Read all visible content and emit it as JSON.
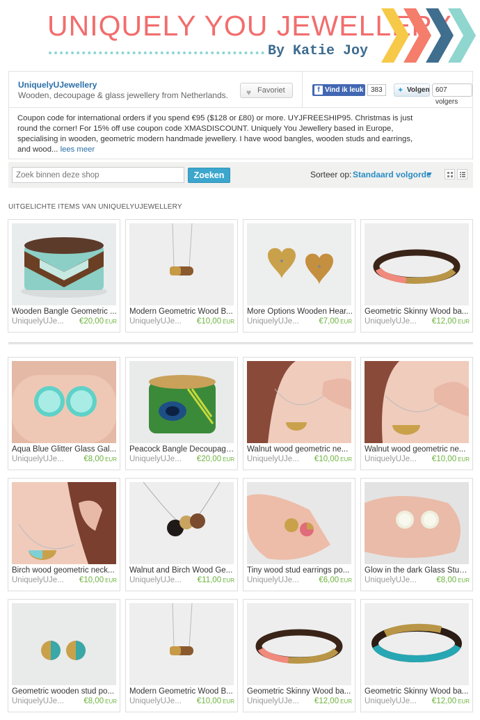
{
  "banner": {
    "title": "UNIQUELY YOU JEWELLERY",
    "subtitle": "By Katie Joy",
    "chevron_colors": [
      "#f7c948",
      "#f47d6b",
      "#3f6e8e",
      "#8fd6cf"
    ]
  },
  "shop": {
    "name": "UniquelyUJewellery",
    "tagline": "Wooden, decoupage & glass jewellery from Netherlands.",
    "favorite_label": "Favoriet",
    "fb_label": "Vind ik leuk",
    "fb_count": "383",
    "tw_label": "Volgen",
    "tw_count": "607 volgers",
    "announcement": "Coupon code for international orders if you spend €95 ($128 or £80) or more. UYJFREESHIP95. Christmas is just round the corner! For 15% off use coupon code XMASDISCOUNT. Uniquely You Jewellery based in Europe, specialising in wooden, geometric modern handmade jewellery. I have wood bangles, wooden studs and earrings, and wood...",
    "read_more": "lees meer"
  },
  "search": {
    "placeholder": "Zoek binnen deze shop",
    "button": "Zoeken",
    "sort_label": "Sorteer op:",
    "sort_value": "Standaard volgorde"
  },
  "featured_title": "UITGELICHTE ITEMS VAN UNIQUELYUJEWELLERY",
  "currency": "EUR",
  "featured": [
    {
      "title": "Wooden Bangle Geometric ...",
      "shop": "UniquelyUJe...",
      "price": "€20,00"
    },
    {
      "title": "Modern Geometric Wood B...",
      "shop": "UniquelyUJe...",
      "price": "€10,00"
    },
    {
      "title": "More Options Wooden Hear...",
      "shop": "UniquelyUJe...",
      "price": "€7,00"
    },
    {
      "title": "Geometric Skinny Wood ba...",
      "shop": "UniquelyUJe...",
      "price": "€12,00"
    }
  ],
  "items": [
    {
      "title": "Aqua Blue Glitter Glass Gal...",
      "shop": "UniquelyUJe...",
      "price": "€8,00"
    },
    {
      "title": "Peacock Bangle Decoupage...",
      "shop": "UniquelyUJe...",
      "price": "€20,00"
    },
    {
      "title": "Walnut wood geometric ne...",
      "shop": "UniquelyUJe...",
      "price": "€10,00"
    },
    {
      "title": "Walnut wood geometric ne...",
      "shop": "UniquelyUJe...",
      "price": "€10,00"
    },
    {
      "title": "Birch wood geometric neck...",
      "shop": "UniquelyUJe...",
      "price": "€10,00"
    },
    {
      "title": "Walnut and Birch Wood Ge...",
      "shop": "UniquelyUJe...",
      "price": "€11,00"
    },
    {
      "title": "Tiny wood stud earrings po...",
      "shop": "UniquelyUJe...",
      "price": "€6,00"
    },
    {
      "title": "Glow in the dark Glass Stud...",
      "shop": "UniquelyUJe...",
      "price": "€8,00"
    },
    {
      "title": "Geometric wooden stud po...",
      "shop": "UniquelyUJe...",
      "price": "€8,00"
    },
    {
      "title": "Modern Geometric Wood B...",
      "shop": "UniquelyUJe...",
      "price": "€10,00"
    },
    {
      "title": "Geometric Skinny Wood ba...",
      "shop": "UniquelyUJe...",
      "price": "€12,00"
    },
    {
      "title": "Geometric Skinny Wood ba...",
      "shop": "UniquelyUJe...",
      "price": "€12,00"
    }
  ]
}
